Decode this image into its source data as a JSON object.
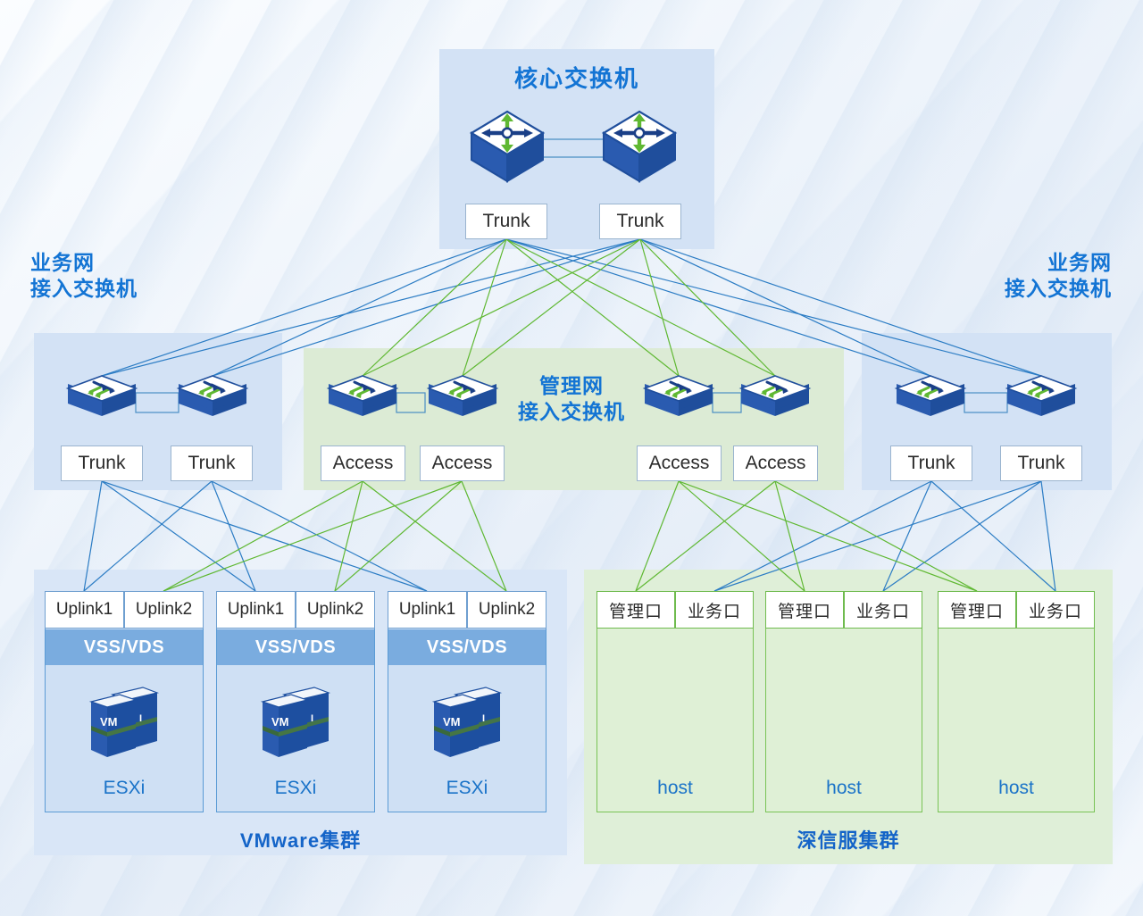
{
  "diagram": {
    "title_core": "核心交换机",
    "title_biz_left": "业务网\n接入交换机",
    "title_biz_right": "业务网\n接入交换机",
    "title_mgmt": "管理网\n接入交换机",
    "colors": {
      "accent_blue": "#1374d4",
      "cluster_title": "#1464c8",
      "link_blue": "#2b7cc4",
      "link_green": "#5fb832",
      "panel_blue": "#d3e2f5",
      "panel_green": "#dcebd5",
      "vss_bar": "#7aacdf",
      "switch_body": "#1f4e9c",
      "host_border_blue": "#5b9bd5",
      "host_border_green": "#79c356"
    }
  },
  "core": {
    "switches": [
      {
        "icon": "core-switch-icon"
      },
      {
        "icon": "core-switch-icon"
      }
    ],
    "tags": [
      "Trunk",
      "Trunk"
    ]
  },
  "access_biz_left": {
    "switches": [
      {
        "icon": "stack-switch-icon"
      },
      {
        "icon": "stack-switch-icon"
      }
    ],
    "tags": [
      "Trunk",
      "Trunk"
    ]
  },
  "access_mgmt": {
    "switches": [
      {
        "icon": "stack-switch-icon"
      },
      {
        "icon": "stack-switch-icon"
      },
      {
        "icon": "stack-switch-icon"
      },
      {
        "icon": "stack-switch-icon"
      }
    ],
    "tags": [
      "Access",
      "Access",
      "Access",
      "Access"
    ]
  },
  "access_biz_right": {
    "switches": [
      {
        "icon": "stack-switch-icon"
      },
      {
        "icon": "stack-switch-icon"
      }
    ],
    "tags": [
      "Trunk",
      "Trunk"
    ]
  },
  "vmware_cluster": {
    "title": "VMware集群",
    "hosts": [
      {
        "uplink1": "Uplink1",
        "uplink2": "Uplink2",
        "switch_label": "VSS/VDS",
        "name": "ESXi",
        "icon": "vm-stack-icon"
      },
      {
        "uplink1": "Uplink1",
        "uplink2": "Uplink2",
        "switch_label": "VSS/VDS",
        "name": "ESXi",
        "icon": "vm-stack-icon"
      },
      {
        "uplink1": "Uplink1",
        "uplink2": "Uplink2",
        "switch_label": "VSS/VDS",
        "name": "ESXi",
        "icon": "vm-stack-icon"
      }
    ]
  },
  "sangfor_cluster": {
    "title": "深信服集群",
    "hosts": [
      {
        "mgmt_port": "管理口",
        "biz_port": "业务口",
        "name": "host"
      },
      {
        "mgmt_port": "管理口",
        "biz_port": "业务口",
        "name": "host"
      },
      {
        "mgmt_port": "管理口",
        "biz_port": "业务口",
        "name": "host"
      }
    ]
  }
}
